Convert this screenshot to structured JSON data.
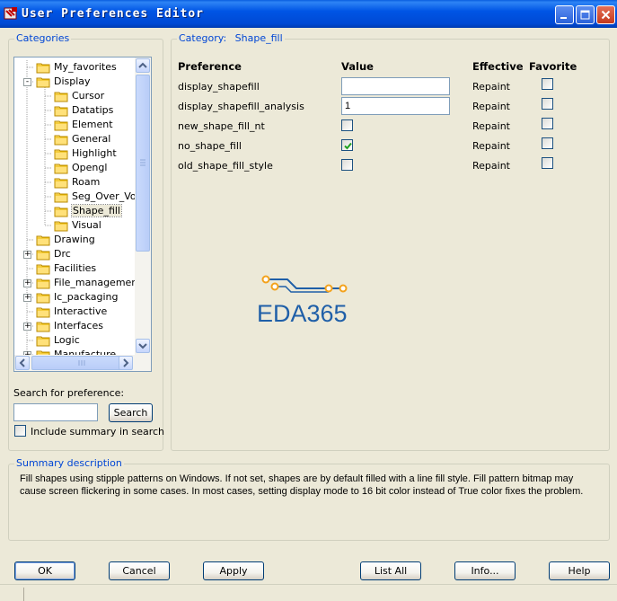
{
  "window": {
    "title": "User Preferences Editor"
  },
  "categories": {
    "legend": "Categories",
    "tree": [
      {
        "label": "My_favorites",
        "level": 0,
        "expander": ""
      },
      {
        "label": "Display",
        "level": 0,
        "expander": "-"
      },
      {
        "label": "Cursor",
        "level": 1,
        "expander": ""
      },
      {
        "label": "Datatips",
        "level": 1,
        "expander": ""
      },
      {
        "label": "Element",
        "level": 1,
        "expander": ""
      },
      {
        "label": "General",
        "level": 1,
        "expander": ""
      },
      {
        "label": "Highlight",
        "level": 1,
        "expander": ""
      },
      {
        "label": "Opengl",
        "level": 1,
        "expander": ""
      },
      {
        "label": "Roam",
        "level": 1,
        "expander": ""
      },
      {
        "label": "Seg_Over_Voi",
        "level": 1,
        "expander": ""
      },
      {
        "label": "Shape_fill",
        "level": 1,
        "expander": "",
        "selected": true
      },
      {
        "label": "Visual",
        "level": 1,
        "expander": ""
      },
      {
        "label": "Drawing",
        "level": 0,
        "expander": ""
      },
      {
        "label": "Drc",
        "level": 0,
        "expander": "+"
      },
      {
        "label": "Facilities",
        "level": 0,
        "expander": ""
      },
      {
        "label": "File_management",
        "level": 0,
        "expander": "+"
      },
      {
        "label": "Ic_packaging",
        "level": 0,
        "expander": "+"
      },
      {
        "label": "Interactive",
        "level": 0,
        "expander": ""
      },
      {
        "label": "Interfaces",
        "level": 0,
        "expander": "+"
      },
      {
        "label": "Logic",
        "level": 0,
        "expander": ""
      },
      {
        "label": "Manufacture",
        "level": 0,
        "expander": "+"
      }
    ]
  },
  "search": {
    "label": "Search for preference:",
    "value": "",
    "button": "Search",
    "include_summary_label": "Include summary in search",
    "include_summary_checked": false
  },
  "category_panel": {
    "legend_prefix": "Category:",
    "category_name": "Shape_fill",
    "headers": {
      "preference": "Preference",
      "value": "Value",
      "effective": "Effective",
      "favorite": "Favorite"
    },
    "rows": [
      {
        "name": "display_shapefill",
        "value_type": "text",
        "value": "",
        "effective": "Repaint",
        "favorite": false
      },
      {
        "name": "display_shapefill_analysis",
        "value_type": "text",
        "value": "1",
        "effective": "Repaint",
        "favorite": false
      },
      {
        "name": "new_shape_fill_nt",
        "value_type": "checkbox",
        "checked": false,
        "effective": "Repaint",
        "favorite": false
      },
      {
        "name": "no_shape_fill",
        "value_type": "checkbox",
        "checked": true,
        "effective": "Repaint",
        "favorite": false
      },
      {
        "name": "old_shape_fill_style",
        "value_type": "checkbox",
        "checked": false,
        "effective": "Repaint",
        "favorite": false
      }
    ],
    "watermark": "EDA365"
  },
  "summary": {
    "legend": "Summary description",
    "text": "Fill shapes using stipple patterns on Windows. If not set, shapes are by default filled with a line fill style. Fill pattern bitmap may cause screen flickering in some cases. In most cases, setting display mode to 16 bit color instead of True color fixes the problem."
  },
  "buttons": {
    "ok": "OK",
    "cancel": "Cancel",
    "apply": "Apply",
    "list_all": "List All",
    "info": "Info...",
    "help": "Help"
  },
  "colors": {
    "titlebar": "#0055E5",
    "legend": "#0046D5",
    "watermark_blue": "#1F5FA8",
    "watermark_orange": "#F3A21C"
  }
}
